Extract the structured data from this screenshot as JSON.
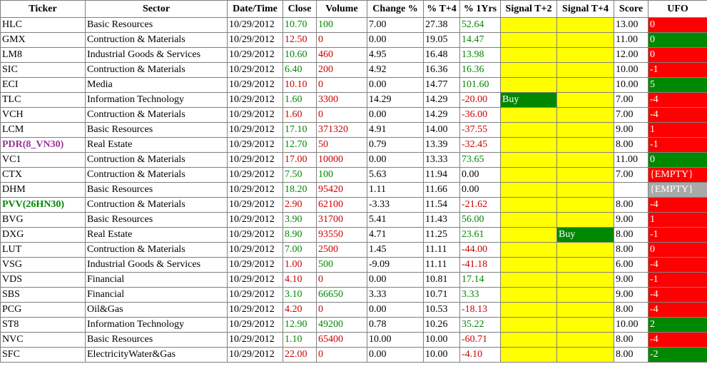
{
  "headers": [
    "Ticker",
    "Sector",
    "Date/Time",
    "Close",
    "Volume",
    "Change %",
    "% T+4",
    "% 1Yrs",
    "Signal T+2",
    "Signal T+4",
    "Score",
    "UFO"
  ],
  "colors": {
    "up": "#008800",
    "down": "#cc0000",
    "signal_yellow": "#ffff00",
    "buy_green": "#008800",
    "ufo_red": "#ff0000",
    "ufo_green": "#008800",
    "ufo_gray": "#a9a9a9"
  },
  "rows": [
    {
      "ticker": "HLC",
      "ticker_style": "",
      "sector": "Basic Resources",
      "date": "10/29/2012",
      "close": "10.70",
      "close_dir": "up",
      "volume": "100",
      "volume_dir": "up",
      "change": "7.00",
      "t4": "27.38",
      "yr1": "52.64",
      "yr1_dir": "up",
      "sig2": "",
      "sig2_style": "",
      "sig4": "",
      "sig4_style": "",
      "score": "13.00",
      "ufo": "0",
      "ufo_style": "zero-red"
    },
    {
      "ticker": "GMX",
      "ticker_style": "",
      "sector": "Contruction & Materials",
      "date": "10/29/2012",
      "close": "12.50",
      "close_dir": "down",
      "volume": "0",
      "volume_dir": "down",
      "change": "0.00",
      "t4": "19.05",
      "yr1": "14.47",
      "yr1_dir": "up",
      "sig2": "",
      "sig2_style": "",
      "sig4": "",
      "sig4_style": "",
      "score": "11.00",
      "ufo": "0",
      "ufo_style": "pos"
    },
    {
      "ticker": "LM8",
      "ticker_style": "",
      "sector": "Industrial Goods & Services",
      "date": "10/29/2012",
      "close": "10.60",
      "close_dir": "up",
      "volume": "460",
      "volume_dir": "down",
      "change": "4.95",
      "t4": "16.48",
      "yr1": "13.98",
      "yr1_dir": "up",
      "sig2": "",
      "sig2_style": "",
      "sig4": "",
      "sig4_style": "",
      "score": "12.00",
      "ufo": "0",
      "ufo_style": "zero-red"
    },
    {
      "ticker": "SIC",
      "ticker_style": "",
      "sector": "Contruction & Materials",
      "date": "10/29/2012",
      "close": "6.40",
      "close_dir": "up",
      "volume": "200",
      "volume_dir": "down",
      "change": "4.92",
      "t4": "16.36",
      "yr1": "16.36",
      "yr1_dir": "up",
      "sig2": "",
      "sig2_style": "",
      "sig4": "",
      "sig4_style": "",
      "score": "10.00",
      "ufo": "-1",
      "ufo_style": "neg"
    },
    {
      "ticker": "ECI",
      "ticker_style": "",
      "sector": "Media",
      "date": "10/29/2012",
      "close": "10.10",
      "close_dir": "down",
      "volume": "0",
      "volume_dir": "down",
      "change": "0.00",
      "t4": "14.77",
      "yr1": "101.60",
      "yr1_dir": "up",
      "sig2": "",
      "sig2_style": "",
      "sig4": "",
      "sig4_style": "",
      "score": "10.00",
      "ufo": "5",
      "ufo_style": "pos"
    },
    {
      "ticker": "TLC",
      "ticker_style": "",
      "sector": "Information Technology",
      "date": "10/29/2012",
      "close": "1.60",
      "close_dir": "up",
      "volume": "3300",
      "volume_dir": "down",
      "change": "14.29",
      "t4": "14.29",
      "yr1": "-20.00",
      "yr1_dir": "down",
      "sig2": "Buy",
      "sig2_style": "buy",
      "sig4": "",
      "sig4_style": "",
      "score": "7.00",
      "ufo": "-4",
      "ufo_style": "neg"
    },
    {
      "ticker": "VCH",
      "ticker_style": "",
      "sector": "Contruction & Materials",
      "date": "10/29/2012",
      "close": "1.60",
      "close_dir": "down",
      "volume": "0",
      "volume_dir": "down",
      "change": "0.00",
      "t4": "14.29",
      "yr1": "-36.00",
      "yr1_dir": "down",
      "sig2": "",
      "sig2_style": "",
      "sig4": "",
      "sig4_style": "",
      "score": "7.00",
      "ufo": "-4",
      "ufo_style": "neg"
    },
    {
      "ticker": "LCM",
      "ticker_style": "",
      "sector": "Basic Resources",
      "date": "10/29/2012",
      "close": "17.10",
      "close_dir": "up",
      "volume": "371320",
      "volume_dir": "down",
      "change": "4.91",
      "t4": "14.00",
      "yr1": "-37.55",
      "yr1_dir": "down",
      "sig2": "",
      "sig2_style": "",
      "sig4": "",
      "sig4_style": "",
      "score": "9.00",
      "ufo": "1",
      "ufo_style": "neg"
    },
    {
      "ticker": "PDR(8_VN30)",
      "ticker_style": "purple",
      "sector": "Real Estate",
      "date": "10/29/2012",
      "close": "12.70",
      "close_dir": "up",
      "volume": "50",
      "volume_dir": "down",
      "change": "0.79",
      "t4": "13.39",
      "yr1": "-32.45",
      "yr1_dir": "down",
      "sig2": "",
      "sig2_style": "",
      "sig4": "",
      "sig4_style": "",
      "score": "8.00",
      "ufo": "-1",
      "ufo_style": "neg"
    },
    {
      "ticker": "VC1",
      "ticker_style": "",
      "sector": "Contruction & Materials",
      "date": "10/29/2012",
      "close": "17.00",
      "close_dir": "down",
      "volume": "10000",
      "volume_dir": "down",
      "change": "0.00",
      "t4": "13.33",
      "yr1": "73.65",
      "yr1_dir": "up",
      "sig2": "",
      "sig2_style": "",
      "sig4": "",
      "sig4_style": "",
      "score": "11.00",
      "ufo": "0",
      "ufo_style": "pos"
    },
    {
      "ticker": "CTX",
      "ticker_style": "",
      "sector": "Contruction & Materials",
      "date": "10/29/2012",
      "close": "7.50",
      "close_dir": "up",
      "volume": "100",
      "volume_dir": "up",
      "change": "5.63",
      "t4": "11.94",
      "yr1": "0.00",
      "yr1_dir": "flat",
      "sig2": "",
      "sig2_style": "",
      "sig4": "",
      "sig4_style": "",
      "score": "7.00",
      "ufo": "{EMPTY}",
      "ufo_style": "empty-red"
    },
    {
      "ticker": "DHM",
      "ticker_style": "",
      "sector": "Basic Resources",
      "date": "10/29/2012",
      "close": "18.20",
      "close_dir": "up",
      "volume": "95420",
      "volume_dir": "down",
      "change": "1.11",
      "t4": "11.66",
      "yr1": "0.00",
      "yr1_dir": "flat",
      "sig2": "",
      "sig2_style": "",
      "sig4": "",
      "sig4_style": "",
      "score": "",
      "ufo": "{EMPTY}",
      "ufo_style": "empty-gray"
    },
    {
      "ticker": "PVV(26HN30)",
      "ticker_style": "green",
      "sector": "Contruction & Materials",
      "date": "10/29/2012",
      "close": "2.90",
      "close_dir": "down",
      "volume": "62100",
      "volume_dir": "down",
      "change": "-3.33",
      "t4": "11.54",
      "yr1": "-21.62",
      "yr1_dir": "down",
      "sig2": "",
      "sig2_style": "",
      "sig4": "",
      "sig4_style": "",
      "score": "8.00",
      "ufo": "-4",
      "ufo_style": "neg"
    },
    {
      "ticker": "BVG",
      "ticker_style": "",
      "sector": "Basic Resources",
      "date": "10/29/2012",
      "close": "3.90",
      "close_dir": "up",
      "volume": "31700",
      "volume_dir": "down",
      "change": "5.41",
      "t4": "11.43",
      "yr1": "56.00",
      "yr1_dir": "up",
      "sig2": "",
      "sig2_style": "",
      "sig4": "",
      "sig4_style": "",
      "score": "9.00",
      "ufo": "1",
      "ufo_style": "neg"
    },
    {
      "ticker": "DXG",
      "ticker_style": "",
      "sector": "Real Estate",
      "date": "10/29/2012",
      "close": "8.90",
      "close_dir": "up",
      "volume": "93550",
      "volume_dir": "down",
      "change": "4.71",
      "t4": "11.25",
      "yr1": "23.61",
      "yr1_dir": "up",
      "sig2": "",
      "sig2_style": "",
      "sig4": "Buy",
      "sig4_style": "buy",
      "score": "8.00",
      "ufo": "-1",
      "ufo_style": "neg"
    },
    {
      "ticker": "LUT",
      "ticker_style": "",
      "sector": "Contruction & Materials",
      "date": "10/29/2012",
      "close": "7.00",
      "close_dir": "up",
      "volume": "2500",
      "volume_dir": "down",
      "change": "1.45",
      "t4": "11.11",
      "yr1": "-44.00",
      "yr1_dir": "down",
      "sig2": "",
      "sig2_style": "",
      "sig4": "",
      "sig4_style": "",
      "score": "8.00",
      "ufo": "0",
      "ufo_style": "zero-red"
    },
    {
      "ticker": "VSG",
      "ticker_style": "",
      "sector": "Industrial Goods & Services",
      "date": "10/29/2012",
      "close": "1.00",
      "close_dir": "down",
      "volume": "500",
      "volume_dir": "up",
      "change": "-9.09",
      "t4": "11.11",
      "yr1": "-41.18",
      "yr1_dir": "down",
      "sig2": "",
      "sig2_style": "",
      "sig4": "",
      "sig4_style": "",
      "score": "6.00",
      "ufo": "-4",
      "ufo_style": "neg"
    },
    {
      "ticker": "VDS",
      "ticker_style": "",
      "sector": "Financial",
      "date": "10/29/2012",
      "close": "4.10",
      "close_dir": "down",
      "volume": "0",
      "volume_dir": "down",
      "change": "0.00",
      "t4": "10.81",
      "yr1": "17.14",
      "yr1_dir": "up",
      "sig2": "",
      "sig2_style": "",
      "sig4": "",
      "sig4_style": "",
      "score": "9.00",
      "ufo": "-1",
      "ufo_style": "neg"
    },
    {
      "ticker": "SBS",
      "ticker_style": "",
      "sector": "Financial",
      "date": "10/29/2012",
      "close": "3.10",
      "close_dir": "up",
      "volume": "66650",
      "volume_dir": "up",
      "change": "3.33",
      "t4": "10.71",
      "yr1": "3.33",
      "yr1_dir": "up",
      "sig2": "",
      "sig2_style": "",
      "sig4": "",
      "sig4_style": "",
      "score": "9.00",
      "ufo": "-4",
      "ufo_style": "neg"
    },
    {
      "ticker": "PCG",
      "ticker_style": "",
      "sector": "Oil&Gas",
      "date": "10/29/2012",
      "close": "4.20",
      "close_dir": "down",
      "volume": "0",
      "volume_dir": "down",
      "change": "0.00",
      "t4": "10.53",
      "yr1": "-18.13",
      "yr1_dir": "down",
      "sig2": "",
      "sig2_style": "",
      "sig4": "",
      "sig4_style": "",
      "score": "8.00",
      "ufo": "-4",
      "ufo_style": "neg"
    },
    {
      "ticker": "ST8",
      "ticker_style": "",
      "sector": "Information Technology",
      "date": "10/29/2012",
      "close": "12.90",
      "close_dir": "up",
      "volume": "49200",
      "volume_dir": "up",
      "change": "0.78",
      "t4": "10.26",
      "yr1": "35.22",
      "yr1_dir": "up",
      "sig2": "",
      "sig2_style": "",
      "sig4": "",
      "sig4_style": "",
      "score": "10.00",
      "ufo": "2",
      "ufo_style": "pos"
    },
    {
      "ticker": "NVC",
      "ticker_style": "",
      "sector": "Basic Resources",
      "date": "10/29/2012",
      "close": "1.10",
      "close_dir": "up",
      "volume": "65400",
      "volume_dir": "down",
      "change": "10.00",
      "t4": "10.00",
      "yr1": "-60.71",
      "yr1_dir": "down",
      "sig2": "",
      "sig2_style": "",
      "sig4": "",
      "sig4_style": "",
      "score": "8.00",
      "ufo": "-4",
      "ufo_style": "neg"
    },
    {
      "ticker": "SFC",
      "ticker_style": "",
      "sector": "ElectricityWater&Gas",
      "date": "10/29/2012",
      "close": "22.00",
      "close_dir": "down",
      "volume": "0",
      "volume_dir": "down",
      "change": "0.00",
      "t4": "10.00",
      "yr1": "-4.10",
      "yr1_dir": "down",
      "sig2": "",
      "sig2_style": "",
      "sig4": "",
      "sig4_style": "",
      "score": "8.00",
      "ufo": "-2",
      "ufo_style": "pos"
    }
  ]
}
